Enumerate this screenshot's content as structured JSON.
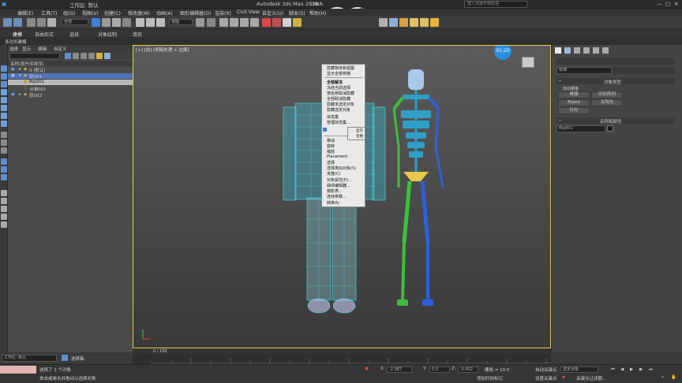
{
  "window": {
    "title": "Autodesk 3ds Max 2016",
    "file": "168A",
    "workspace": "工作区: 默认",
    "search_placeholder": "键入关键字或短语"
  },
  "menu": [
    "编辑(E)",
    "工具(T)",
    "组(G)",
    "视图(V)",
    "创建(C)",
    "修改器(M)",
    "动画(A)",
    "图形编辑器(D)",
    "渲染(R)",
    "Civil View",
    "自定义(U)",
    "脚本(S)",
    "帮助(H)"
  ],
  "toolbar": {
    "filter": "全部",
    "view": "视图",
    "selection_set": "创建选择集"
  },
  "ribbon": {
    "tabs": [
      "建模",
      "自由形式",
      "选择",
      "对象绘制",
      "填充"
    ],
    "active": "建模",
    "sub": "多边形建模"
  },
  "explorer": {
    "tabs": [
      "选择",
      "显示",
      "编辑",
      "自定义"
    ],
    "column_header": "名称(按升序排序)",
    "rows": [
      {
        "label": "0 (默认)",
        "indent": 1
      },
      {
        "label": "层001",
        "indent": 1,
        "selected": true
      },
      {
        "label": "Bip001",
        "indent": 2,
        "highlight": true
      },
      {
        "label": "对象001",
        "indent": 2
      },
      {
        "label": "层002",
        "indent": 1
      }
    ],
    "workspace_label": "工作区: 默认",
    "selection_set_label": "选择集:"
  },
  "viewport": {
    "label": "[+] [前] [明暗处理 + 边面]",
    "timer": "01:20",
    "frame": "0 / 100"
  },
  "context_menu": {
    "items": [
      "隐藏物体和视图",
      "显示全部骨骼",
      "全部解冻",
      "冻结当前选择",
      "按名称取消隐藏",
      "全部取消隐藏",
      "隐藏未选定对象",
      "隐藏选定对象",
      "状态集",
      "管理状态集...",
      "移动",
      "旋转",
      "缩放",
      "Placement",
      "选择",
      "选择类似对象(S)",
      "克隆(C)",
      "对象属性(P)...",
      "曲线编辑器...",
      "摄影表...",
      "连线参数...",
      "转换为:"
    ],
    "side": [
      "显示",
      "变换"
    ]
  },
  "command_panel": {
    "search_placeholder": "标准",
    "rollout1": "对象类型",
    "autogrid": "自动栅格",
    "buttons": [
      "骨骼",
      "环形阵列",
      "Biped",
      "太阳光",
      "日光"
    ],
    "rollout2": "名称和颜色",
    "name_value": "Bip001",
    "name_color": "#1a1a1a"
  },
  "status": {
    "line1": "选择了 1 个对象",
    "line2": "单击或单击并拖动以选择对象",
    "x_label": "X:",
    "x_value": "-2.987",
    "y_label": "Y:",
    "y_value": "0.0",
    "z_label": "Z:",
    "z_value": "-0.602",
    "grid": "栅格 = 10.0",
    "add_time_tag": "添加时间标记",
    "autokey": "自动关键点",
    "setkey": "设置关键点",
    "selected": "选定对象",
    "key_filters": "关键点过滤器..."
  },
  "colors": {
    "accent": "#e8c94a",
    "highlight": "#4a7fd0",
    "cyan": "#3fd6e6",
    "green": "#3cc03c",
    "blue": "#2f5fd8",
    "yellow": "#e6c94a"
  }
}
